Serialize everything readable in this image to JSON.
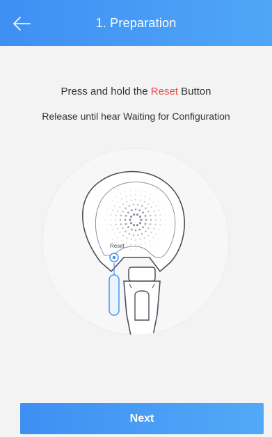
{
  "header": {
    "title": "1. Preparation",
    "back_icon": "arrow-left-icon"
  },
  "instructions": {
    "line1_prefix": "Press and hold the ",
    "line1_highlight": "Reset",
    "line1_suffix": " Button",
    "line2": "Release until hear Waiting for Configuration"
  },
  "illustration": {
    "reset_label": "Reset"
  },
  "footer": {
    "next_label": "Next"
  },
  "colors": {
    "accent": "#4597f5",
    "highlight": "#f0474f",
    "background": "#f3f3f3"
  }
}
